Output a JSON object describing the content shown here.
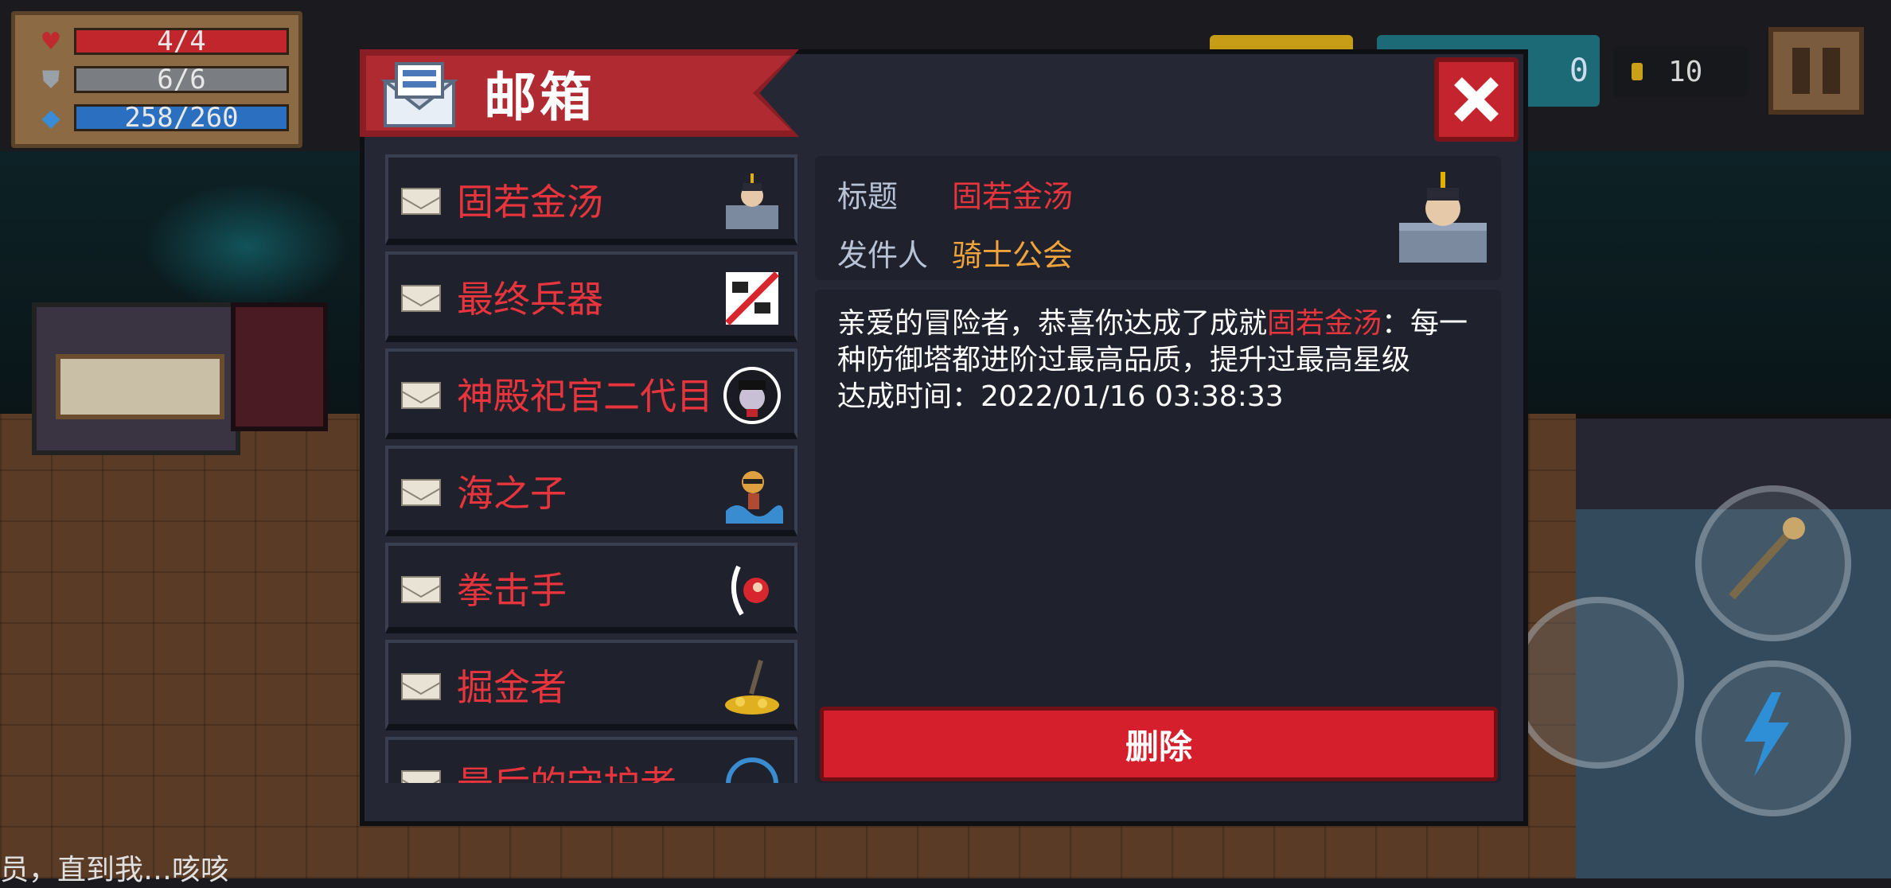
{
  "hud": {
    "hp": "4/4",
    "armor": "6/6",
    "energy": "258/260",
    "teal_counter": "0",
    "coins": "10"
  },
  "mailbox": {
    "title": "邮箱",
    "items": [
      {
        "label": "固若金汤",
        "thumb": "knight-tower-icon"
      },
      {
        "label": "最终兵器",
        "thumb": "ultimate-weapon-icon"
      },
      {
        "label": "神殿祀官二代目",
        "thumb": "priest-portrait-icon"
      },
      {
        "label": "海之子",
        "thumb": "sea-child-icon"
      },
      {
        "label": "拳击手",
        "thumb": "boxer-icon"
      },
      {
        "label": "掘金者",
        "thumb": "gold-digger-icon"
      },
      {
        "label": "最后的守护者",
        "thumb": "guardian-icon"
      }
    ],
    "detail": {
      "title_label": "标题",
      "title_value": "固若金汤",
      "sender_label": "发件人",
      "sender_value": "骑士公会",
      "body_prefix": "亲爱的冒险者，恭喜你达成了成就",
      "body_highlight": "固若金汤",
      "body_suffix": "：每一种防御塔都进阶过最高品质，提升过最高星级",
      "achieved_label": "达成时间：",
      "achieved_time": "2022/01/16 03:38:33",
      "delete_label": "删除"
    }
  },
  "chat": {
    "line": "员，直到我…咳咳"
  },
  "colors": {
    "accent_red": "#e8343c",
    "sender_orange": "#f0a33a",
    "header_red": "#b02a32"
  }
}
